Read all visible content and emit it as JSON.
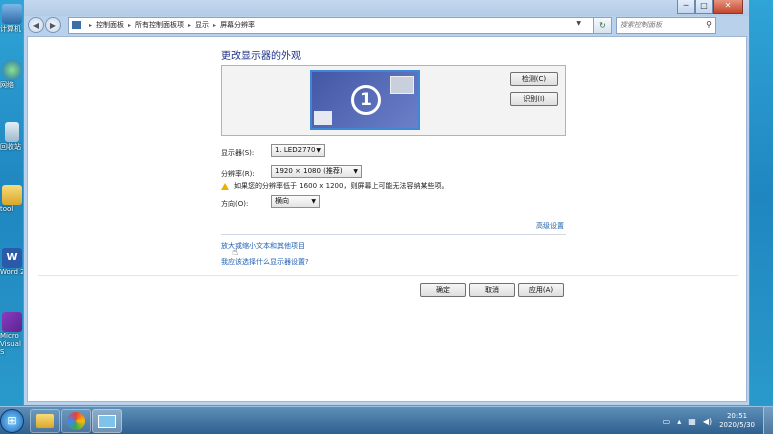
{
  "desktop": {
    "icons": [
      {
        "label": "计算机",
        "icon": "computer-icon"
      },
      {
        "label": "网络",
        "icon": "network-icon"
      },
      {
        "label": "回收站",
        "icon": "recycle-bin-icon"
      },
      {
        "label": "tool",
        "icon": "folder-icon"
      },
      {
        "label": "Word 2",
        "icon": "word-icon"
      },
      {
        "label": "Micro Visual S",
        "icon": "visual-studio-icon"
      }
    ]
  },
  "window": {
    "controls": {
      "minimize": "─",
      "maximize": "□",
      "close": "✕"
    },
    "breadcrumb": [
      "控制面板",
      "所有控制面板项",
      "显示",
      "屏幕分辨率"
    ],
    "search_placeholder": "搜索控制面板",
    "heading": "更改显示器的外观",
    "monitor_number": "1",
    "detect_button": "检测(C)",
    "identify_button": "识别(I)",
    "display_label": "显示器(S):",
    "display_value": "1. LED2770",
    "resolution_label": "分辨率(R):",
    "resolution_value": "1920 × 1080 (推荐)",
    "warning_text": "如果您的分辨率低于 1600 x 1200，则屏幕上可能无法容纳某些项。",
    "orientation_label": "方向(O):",
    "orientation_value": "横向",
    "advanced_link": "高级设置",
    "text_size_link": "放大或缩小文本和其他项目",
    "help_link": "我应该选择什么显示器设置?",
    "ok_button": "确定",
    "cancel_button": "取消",
    "apply_button": "应用(A)"
  },
  "taskbar": {
    "start_icon": "windows-start-icon",
    "time": "20:51",
    "date": "2020/5/30"
  },
  "colors": {
    "heading": "#1e3287",
    "link": "#1f5fb0",
    "monitor": "#4357a6",
    "close": "#c4452d"
  }
}
